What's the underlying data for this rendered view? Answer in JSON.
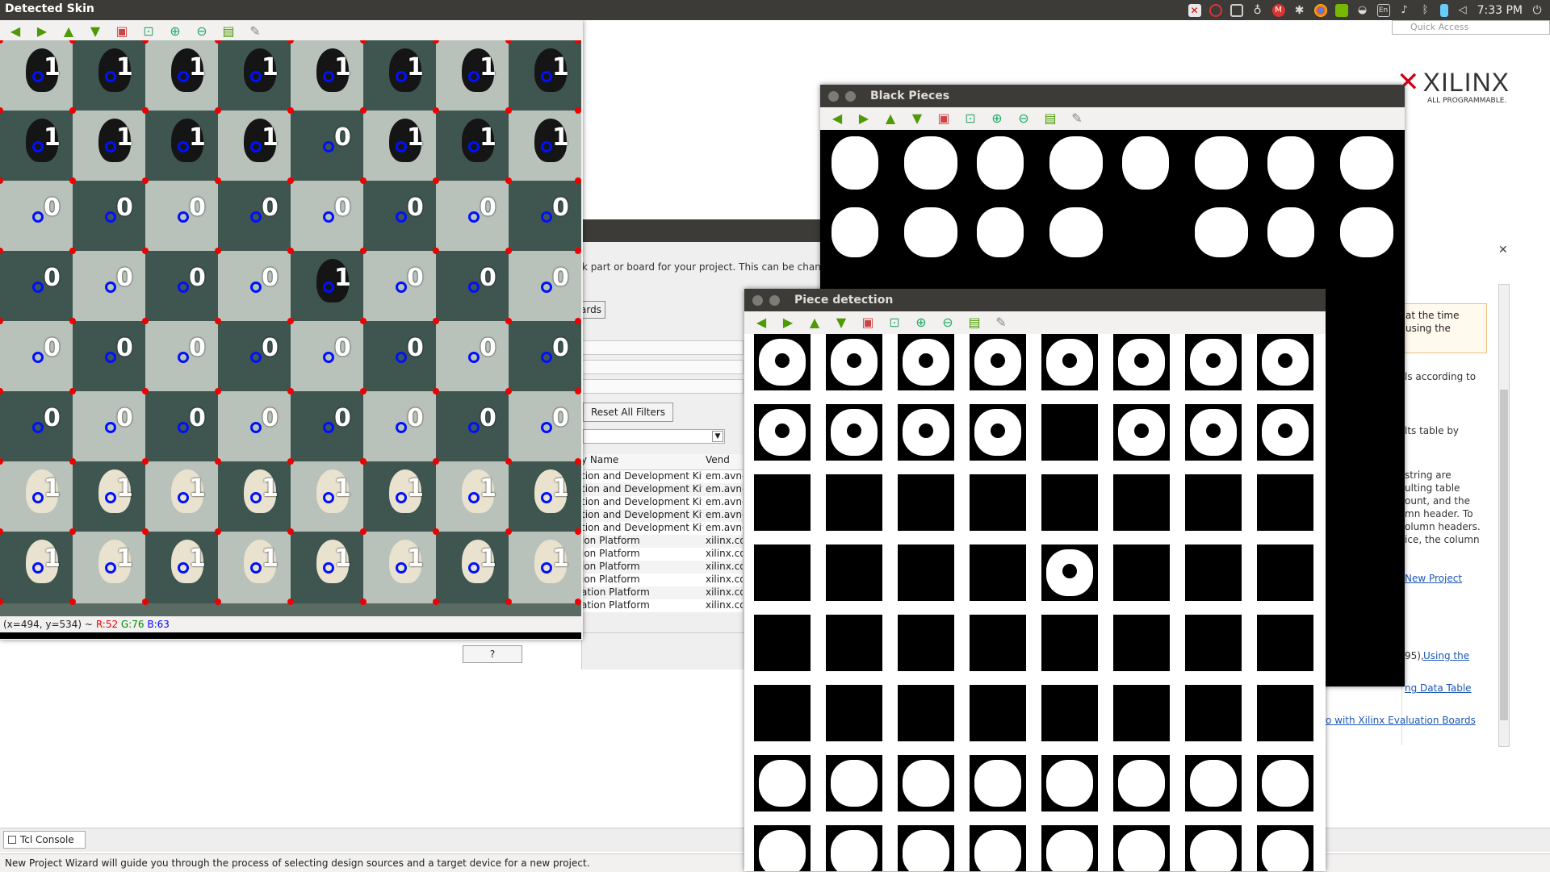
{
  "topbar": {
    "window_title": "Detected Skin",
    "clock": "7:33 PM",
    "tray_icons": [
      "xilinx-tray-icon",
      "ubuntu-one-icon",
      "image-viewer-icon",
      "indicator-icon",
      "gmail-icon",
      "settings-icon",
      "chrome-icon",
      "nvidia-icon",
      "wifi-icon",
      "keyboard-icon",
      "lang-en-icon",
      "notification-icon",
      "bluetooth-icon",
      "battery-icon",
      "volume-icon",
      "power-icon"
    ],
    "lang": "En"
  },
  "vivado": {
    "quick_access_placeholder": "Quick Access",
    "logo_text": "XILINX",
    "logo_sub": "ALL PROGRAMMABLE.",
    "wizard_desc": "k part or board for your project. This can be chang",
    "boards_button": "ards",
    "reset_button": "Reset All Filters",
    "table_headers": [
      "y Name",
      "Vend"
    ],
    "table_rows": [
      [
        "tion and Development Kit",
        "em.avne"
      ],
      [
        "tion and Development Kit",
        "em.avne"
      ],
      [
        "tion and Development Kit",
        "em.avne"
      ],
      [
        "tion and Development Kit",
        "em.avne"
      ],
      [
        "tion and Development Kit",
        "em.avne"
      ],
      [
        "ion Platform",
        "xilinx.co"
      ],
      [
        "ion Platform",
        "xilinx.co"
      ],
      [
        "ion Platform",
        "xilinx.co"
      ],
      [
        "ion Platform",
        "xilinx.co"
      ],
      [
        "ation Platform",
        "xilinx.co"
      ],
      [
        "ation Platform",
        "xilinx.co"
      ]
    ],
    "help_button": "?",
    "right_panel": {
      "info_line1": "at the time",
      "info_line2": "using the",
      "lines": [
        "ls according to",
        "lts table by",
        "string are",
        "ulting table",
        "ount, and the",
        "mn header. To",
        "olumn headers.",
        "ice, the column"
      ],
      "link_new_project": "New Project",
      "text_95": "95),",
      "link_using_the": "Using the",
      "link_data_table": "ng Data Table",
      "link_eval_boards": "o with Xilinx Evaluation Boards"
    },
    "tcl_tab": "Tcl Console",
    "status_text": "New Project Wizard will guide you through the process of selecting design sources and a target device for a new project."
  },
  "skin_window": {
    "title": "Detected Skin",
    "coords": "(x=494, y=534) ~",
    "r": "R:52",
    "g": "G:76",
    "b": "B:63",
    "occupancy": [
      [
        "1",
        "1",
        "1",
        "1",
        "1",
        "1",
        "1",
        "1"
      ],
      [
        "1",
        "1",
        "1",
        "1",
        "0",
        "1",
        "1",
        "1"
      ],
      [
        "0",
        "0",
        "0",
        "0",
        "0",
        "0",
        "0",
        "0"
      ],
      [
        "0",
        "0",
        "0",
        "0",
        "1",
        "0",
        "0",
        "0"
      ],
      [
        "0",
        "0",
        "0",
        "0",
        "0",
        "0",
        "0",
        "0"
      ],
      [
        "0",
        "0",
        "0",
        "0",
        "0",
        "0",
        "0",
        "0"
      ],
      [
        "1",
        "1",
        "1",
        "1",
        "1",
        "1",
        "1",
        "1"
      ],
      [
        "1",
        "1",
        "1",
        "1",
        "1",
        "1",
        "1",
        "1"
      ]
    ]
  },
  "black_window": {
    "title": "Black Pieces"
  },
  "piece_window": {
    "title": "Piece detection"
  },
  "colors": {
    "panel": "#3c3b37",
    "accent_red": "#d0021b",
    "link": "#1c57b5",
    "toolbar_green": "#4e9a06"
  }
}
